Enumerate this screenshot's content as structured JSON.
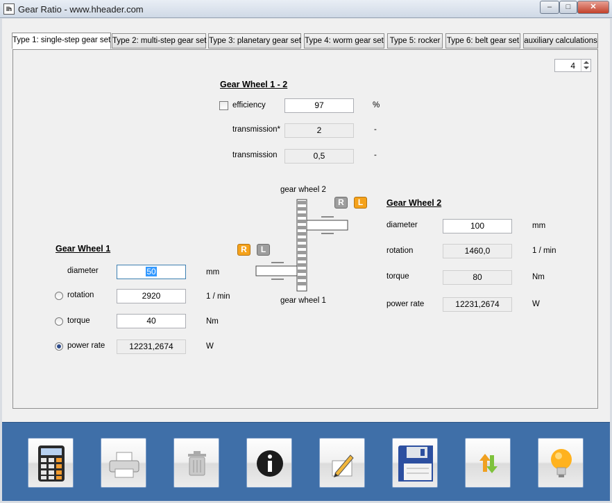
{
  "window": {
    "title": "Gear Ratio - www.hheader.com",
    "icon": "gear-ratio-app-icon",
    "app_icon_text": "Ih"
  },
  "tabs": [
    {
      "label": "Type 1: single-step gear set",
      "active": true
    },
    {
      "label": "Type 2: multi-step gear set",
      "active": false
    },
    {
      "label": "Type 3: planetary gear set",
      "active": false
    },
    {
      "label": "Type 4: worm gear set",
      "active": false
    },
    {
      "label": "Type 5: rocker",
      "active": false
    },
    {
      "label": "Type 6: belt gear set",
      "active": false
    },
    {
      "label": "auxiliary calculations",
      "active": false
    }
  ],
  "precision_spinner": {
    "value": "4"
  },
  "gear_wheel_1_2": {
    "heading": "Gear Wheel 1 - 2",
    "efficiency": {
      "label": "efficiency",
      "value": "97",
      "unit": "%",
      "checked": false
    },
    "transmission_star": {
      "label": "transmission*",
      "value": "2",
      "unit": "-"
    },
    "transmission": {
      "label": "transmission",
      "value": "0,5",
      "unit": "-"
    }
  },
  "gear_wheel_1": {
    "heading": "Gear Wheel 1",
    "diameter": {
      "label": "diameter",
      "value": "50",
      "unit": "mm"
    },
    "rotation": {
      "label": "rotation",
      "value": "2920",
      "unit": "1 / min",
      "selected": false
    },
    "torque": {
      "label": "torque",
      "value": "40",
      "unit": "Nm",
      "selected": false
    },
    "power_rate": {
      "label": "power rate",
      "value": "12231,2674",
      "unit": "W",
      "selected": true
    }
  },
  "gear_wheel_2": {
    "heading": "Gear Wheel 2",
    "diameter": {
      "label": "diameter",
      "value": "100",
      "unit": "mm"
    },
    "rotation": {
      "label": "rotation",
      "value": "1460,0",
      "unit": "1 / min"
    },
    "torque": {
      "label": "torque",
      "value": "80",
      "unit": "Nm"
    },
    "power_rate": {
      "label": "power rate",
      "value": "12231,2674",
      "unit": "W"
    }
  },
  "diagram": {
    "label_gear_2": "gear wheel 2",
    "label_gear_1": "gear wheel 1",
    "direction_right": "R",
    "direction_left": "L",
    "gear_1_active": "R",
    "gear_2_active": "L"
  },
  "toolbar": [
    {
      "name": "calculator",
      "icon": "calculator-icon"
    },
    {
      "name": "print",
      "icon": "printer-icon"
    },
    {
      "name": "delete",
      "icon": "trash-icon"
    },
    {
      "name": "info",
      "icon": "info-icon"
    },
    {
      "name": "edit",
      "icon": "pencil-icon"
    },
    {
      "name": "save",
      "icon": "floppy-disk-icon"
    },
    {
      "name": "swap",
      "icon": "swap-arrows-icon"
    },
    {
      "name": "tips",
      "icon": "light-bulb-icon"
    }
  ]
}
